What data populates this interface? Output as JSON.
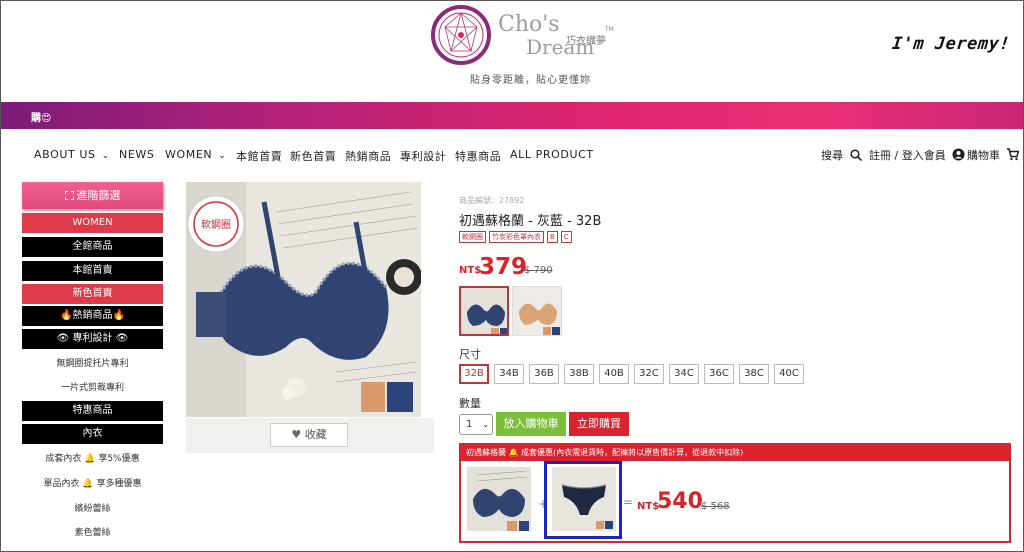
{
  "header": {
    "brand_line1": "Cho's",
    "brand_line2": "Dream",
    "brand_cn": "巧衣織夢",
    "brand_tm": "TM",
    "tagline": "貼身零距離，貼心更懂妳",
    "watermark": "I'm Jeremy!"
  },
  "promo": {
    "text": "購😍"
  },
  "nav": {
    "items": [
      {
        "label": "ABOUT US",
        "chevron": true
      },
      {
        "label": "NEWS",
        "chevron": false
      },
      {
        "label": "WOMEN",
        "chevron": true
      },
      {
        "label": "本館首賣"
      },
      {
        "label": "新色首賣"
      },
      {
        "label": "熱銷商品"
      },
      {
        "label": "專利設計"
      },
      {
        "label": "特惠商品"
      },
      {
        "label": "ALL PRODUCT"
      }
    ],
    "search_label": "搜尋",
    "account_label": "註冊 / 登入會員",
    "cart_label": "購物車"
  },
  "sidebar": {
    "filter_label": "進階篩選",
    "items": [
      {
        "label": "WOMEN"
      },
      {
        "label": "全館商品"
      },
      {
        "label": "本館首賣"
      },
      {
        "label": "新色首賣"
      },
      {
        "label": "🔥熱銷商品🔥"
      },
      {
        "label": "👁 專利設計 👁"
      },
      {
        "label": "無鋼圈提托片專利"
      },
      {
        "label": "一片式剪裁專利"
      },
      {
        "label": "特惠商品"
      },
      {
        "label": "內衣"
      },
      {
        "label": "成套內衣 🔔 享5%優惠"
      },
      {
        "label": "單品內衣 🔔 享多種優惠"
      },
      {
        "label": "繽紛蕾絲"
      },
      {
        "label": "素色蕾絲"
      }
    ]
  },
  "product": {
    "image_badge": "軟鋼圈",
    "favorite_label": "收藏",
    "sku": "商品編號：27892",
    "title": "初遇蘇格蘭 - 灰藍 - 32B",
    "tags": [
      "軟鋼圈",
      "竹炭彩色罩內衣",
      "B",
      "C"
    ],
    "currency": "NT$",
    "price": "379",
    "original_price": "$ 790",
    "size_label": "尺寸",
    "sizes": [
      "32B",
      "34B",
      "36B",
      "38B",
      "40B",
      "32C",
      "34C",
      "36C",
      "38C",
      "40C"
    ],
    "selected_size": "32B",
    "qty_label": "數量",
    "qty_value": "1",
    "add_to_cart": "放入購物車",
    "buy_now": "立即購買"
  },
  "combo": {
    "header": "初遇蘇格蘭 🔔 成套優惠(內衣需退貨時，配褲將以原售價計算，從退款中扣除)",
    "plus": "+",
    "equals": "=",
    "currency": "NT$",
    "price": "540",
    "original_price": "$ 568"
  },
  "colors": {
    "accent_red": "#d9242f",
    "green": "#7cbf3a",
    "promo_pink": "#e0256f",
    "highlight_blue": "#1a22c8"
  }
}
